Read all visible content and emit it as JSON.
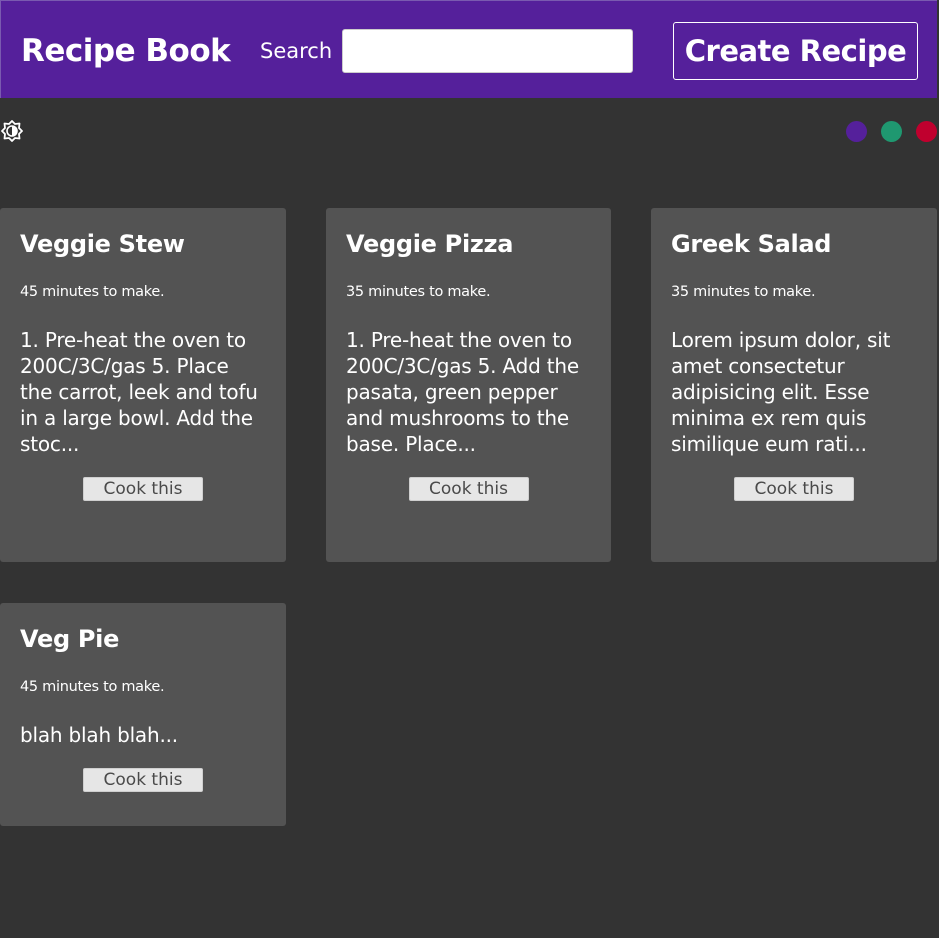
{
  "header": {
    "title": "Recipe Book",
    "search_label": "Search",
    "search_value": "",
    "search_placeholder": "",
    "create_button_label": "Create Recipe"
  },
  "toolbar": {
    "theme_toggle_icon": "contrast-icon",
    "color_options": [
      {
        "name": "purple",
        "color": "#55209b"
      },
      {
        "name": "green",
        "color": "#1f9870"
      },
      {
        "name": "red",
        "color": "#c0002e"
      }
    ]
  },
  "recipes": [
    {
      "title": "Veggie Stew",
      "time": "45 minutes to make.",
      "description": "1. Pre-heat the oven to 200C/3C/gas 5. Place the carrot, leek and tofu in a large bowl. Add the stoc...",
      "button_label": "Cook this"
    },
    {
      "title": "Veggie Pizza",
      "time": "35 minutes to make.",
      "description": "1. Pre-heat the oven to 200C/3C/gas 5. Add the pasata, green pepper and mushrooms to the base. Place...",
      "button_label": "Cook this"
    },
    {
      "title": "Greek Salad",
      "time": "35 minutes to make.",
      "description": "Lorem ipsum dolor, sit amet consectetur adipisicing elit. Esse minima ex rem quis similique eum rati...",
      "button_label": "Cook this"
    },
    {
      "title": "Veg Pie",
      "time": "45 minutes to make.",
      "description": "blah blah blah...",
      "button_label": "Cook this"
    }
  ]
}
